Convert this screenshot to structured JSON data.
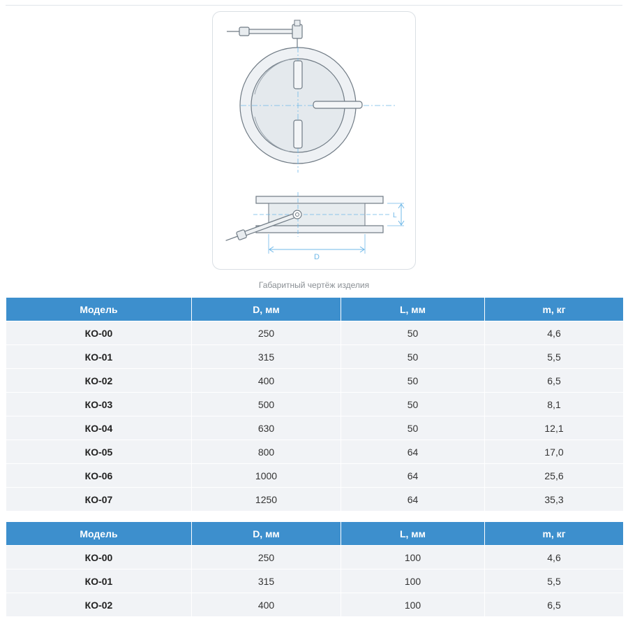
{
  "figure": {
    "caption": "Габаритный чертёж изделия",
    "dimension_labels": {
      "diameter": "D",
      "length": "L"
    }
  },
  "tables": [
    {
      "headers": [
        "Модель",
        "D, мм",
        "L, мм",
        "m, кг"
      ],
      "rows": [
        [
          "КО-00",
          "250",
          "50",
          "4,6"
        ],
        [
          "КО-01",
          "315",
          "50",
          "5,5"
        ],
        [
          "КО-02",
          "400",
          "50",
          "6,5"
        ],
        [
          "КО-03",
          "500",
          "50",
          "8,1"
        ],
        [
          "КО-04",
          "630",
          "50",
          "12,1"
        ],
        [
          "КО-05",
          "800",
          "64",
          "17,0"
        ],
        [
          "КО-06",
          "1000",
          "64",
          "25,6"
        ],
        [
          "КО-07",
          "1250",
          "64",
          "35,3"
        ]
      ]
    },
    {
      "headers": [
        "Модель",
        "D, мм",
        "L, мм",
        "m, кг"
      ],
      "rows": [
        [
          "КО-00",
          "250",
          "100",
          "4,6"
        ],
        [
          "КО-01",
          "315",
          "100",
          "5,5"
        ],
        [
          "КО-02",
          "400",
          "100",
          "6,5"
        ]
      ]
    }
  ],
  "colors": {
    "header_bg": "#3d8fcd",
    "row_bg": "#f1f3f6",
    "drawing_line": "#6f7a84",
    "dimension_line": "#6fb8e8"
  }
}
